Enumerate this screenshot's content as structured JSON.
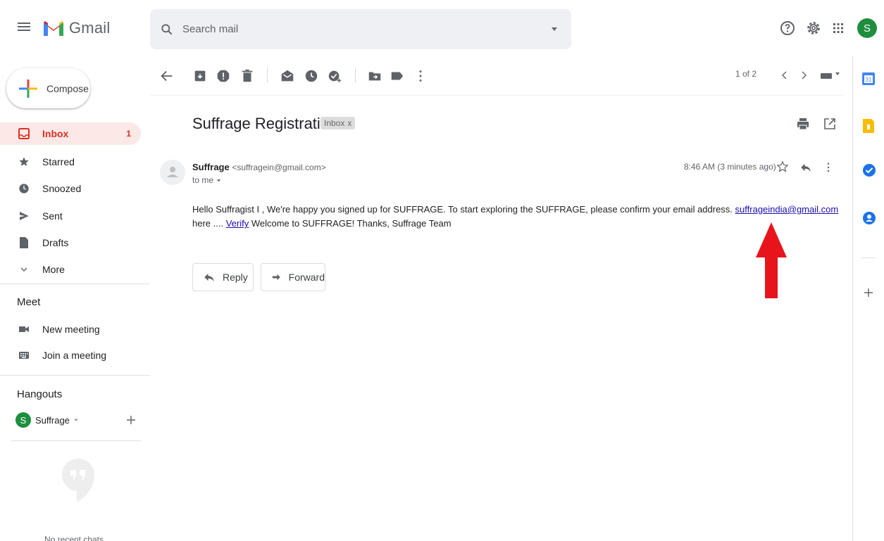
{
  "header": {
    "app_name": "Gmail",
    "search_placeholder": "Search mail",
    "avatar_letter": "S",
    "icons": [
      "menu-icon",
      "help-icon",
      "settings-icon",
      "apps-icon"
    ]
  },
  "nav": {
    "compose_label": "Compose",
    "items": [
      {
        "label": "Inbox",
        "count": "1",
        "icon": "inbox-icon"
      },
      {
        "label": "Starred",
        "icon": "star-icon"
      },
      {
        "label": "Snoozed",
        "icon": "clock-icon"
      },
      {
        "label": "Sent",
        "icon": "send-icon"
      },
      {
        "label": "Drafts",
        "icon": "draft-icon"
      },
      {
        "label": "More",
        "icon": "chevron-down-icon"
      }
    ],
    "meet_title": "Meet",
    "meet_items": [
      {
        "label": "New meeting",
        "icon": "video-icon"
      },
      {
        "label": "Join a meeting",
        "icon": "keyboard-icon"
      }
    ],
    "hangouts_title": "Hangouts",
    "hangouts_user": {
      "letter": "S",
      "name": "Suffrage"
    },
    "no_chats": "No recent chats"
  },
  "toolbar": {
    "pager": "1 of 2"
  },
  "message": {
    "subject": "Suffrage Registration",
    "label_chip": "Inbox",
    "chip_close": "x",
    "sender_name": "Suffrage",
    "sender_email": "<suffragein@gmail.com>",
    "to": "to me",
    "timestamp": "8:46 AM (3 minutes ago)",
    "body_part1": "Hello Suffragist I , We're happy you signed up for SUFFRAGE. To start exploring the SUFFRAGE, please confirm your email address. ",
    "body_link_email": "suffrageindia@gmail.com",
    "body_part2": " here .... ",
    "body_link_verify": "Verify",
    "body_part3": " Welcome to SUFFRAGE! Thanks, Suffrage Team",
    "reply_label": "Reply",
    "forward_label": "Forward"
  },
  "colors": {
    "accent_red": "#d93025",
    "arrow_red": "#e8141c",
    "link": "#1a0dab"
  }
}
